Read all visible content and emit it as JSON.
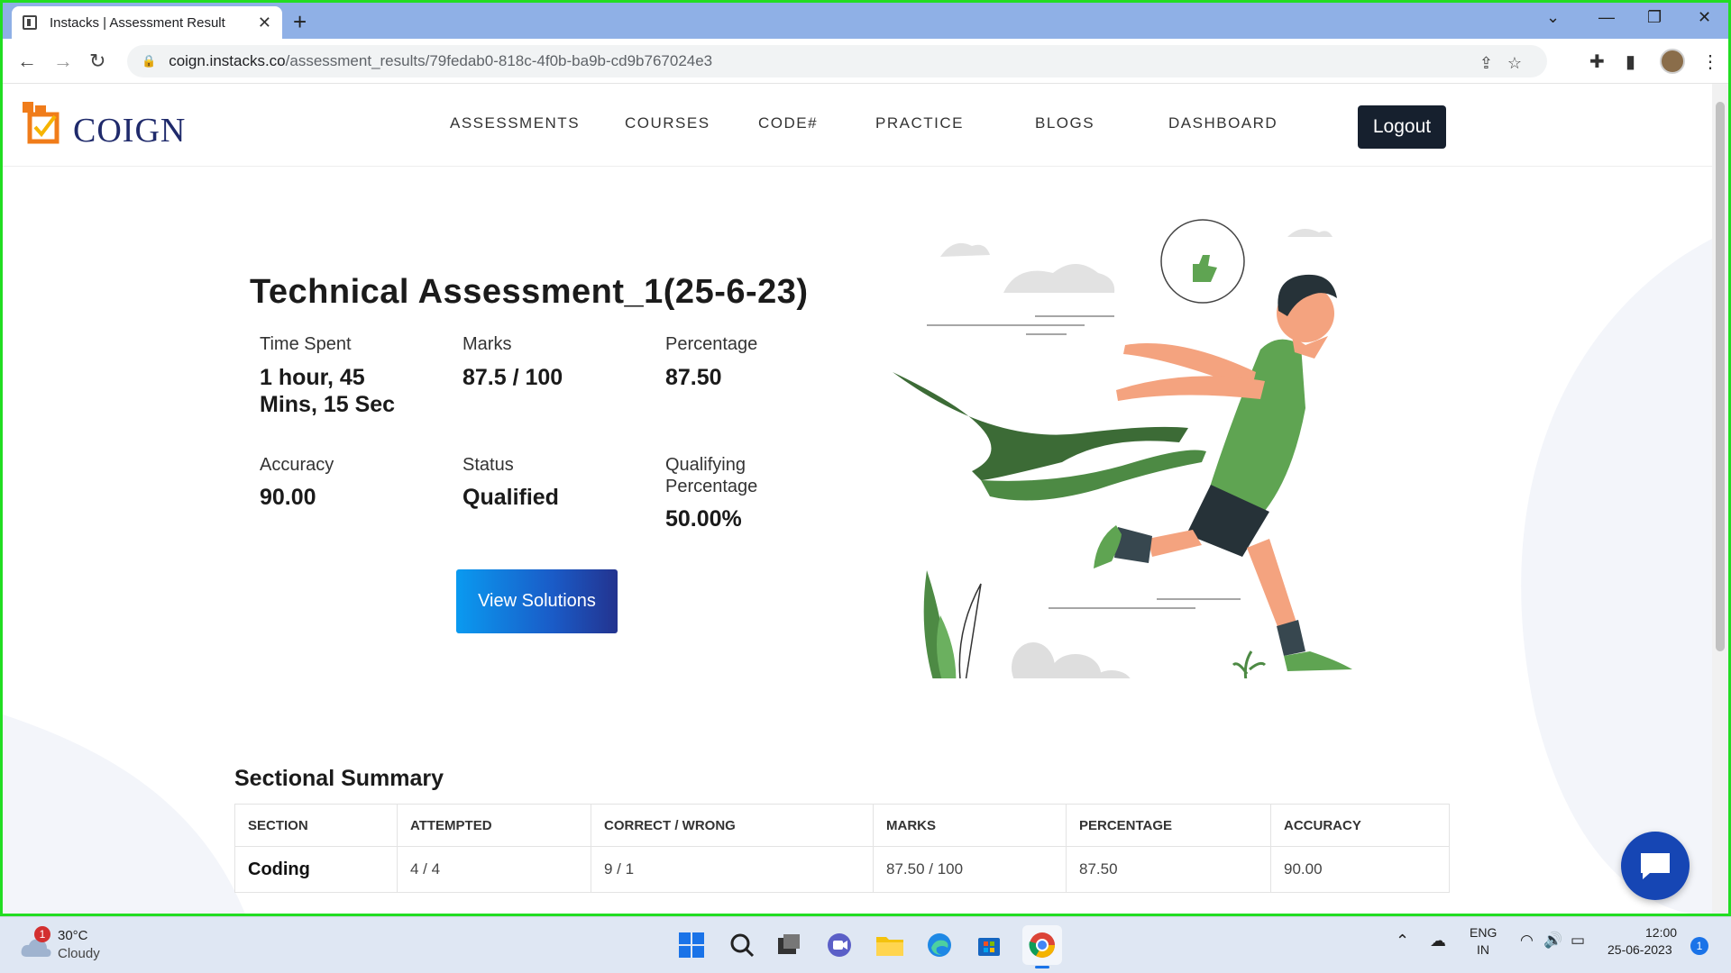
{
  "browser": {
    "tab_title": "Instacks | Assessment Result",
    "url_host": "coign.instacks.co",
    "url_path": "/assessment_results/79fedab0-818c-4f0b-ba9b-cd9b767024e3"
  },
  "site": {
    "logo_text": "COIGN",
    "nav": [
      {
        "label": "ASSESSMENTS"
      },
      {
        "label": "COURSES"
      },
      {
        "label": "CODE#"
      },
      {
        "label": "PRACTICE"
      },
      {
        "label": "BLOGS"
      },
      {
        "label": "DASHBOARD"
      }
    ],
    "logout_label": "Logout"
  },
  "result": {
    "title": "Technical Assessment_1(25-6-23)",
    "stats": {
      "time_spent_label": "Time Spent",
      "time_spent_value_line1": "1 hour, 45",
      "time_spent_value_line2": "Mins, 15 Sec",
      "marks_label": "Marks",
      "marks_value": "87.5 / 100",
      "percentage_label": "Percentage",
      "percentage_value": "87.50",
      "accuracy_label": "Accuracy",
      "accuracy_value": "90.00",
      "status_label": "Status",
      "status_value": "Qualified",
      "qualifying_label_line1": "Qualifying",
      "qualifying_label_line2": "Percentage",
      "qualifying_value": "50.00%"
    },
    "view_solutions_label": "View Solutions"
  },
  "summary": {
    "title": "Sectional Summary",
    "headers": [
      "SECTION",
      "ATTEMPTED",
      "CORRECT / WRONG",
      "MARKS",
      "PERCENTAGE",
      "ACCURACY"
    ],
    "rows": [
      {
        "section": "Coding",
        "attempted": "4 / 4",
        "correct_wrong": "9 / 1",
        "marks": "87.50 / 100",
        "percentage": "87.50",
        "accuracy": "90.00"
      }
    ]
  },
  "taskbar": {
    "weather_temp": "30°C",
    "weather_cond": "Cloudy",
    "weather_badge": "1",
    "lang_line1": "ENG",
    "lang_line2": "IN",
    "time": "12:00",
    "date": "25-06-2023",
    "notif_count": "1"
  },
  "colors": {
    "accent_green": "#22dd22",
    "logout_bg": "#16202e",
    "button_gradient_start": "#0a9af0",
    "button_gradient_end": "#23338f",
    "chat_fab": "#1646b4",
    "runner_shirt": "#5fa452"
  }
}
